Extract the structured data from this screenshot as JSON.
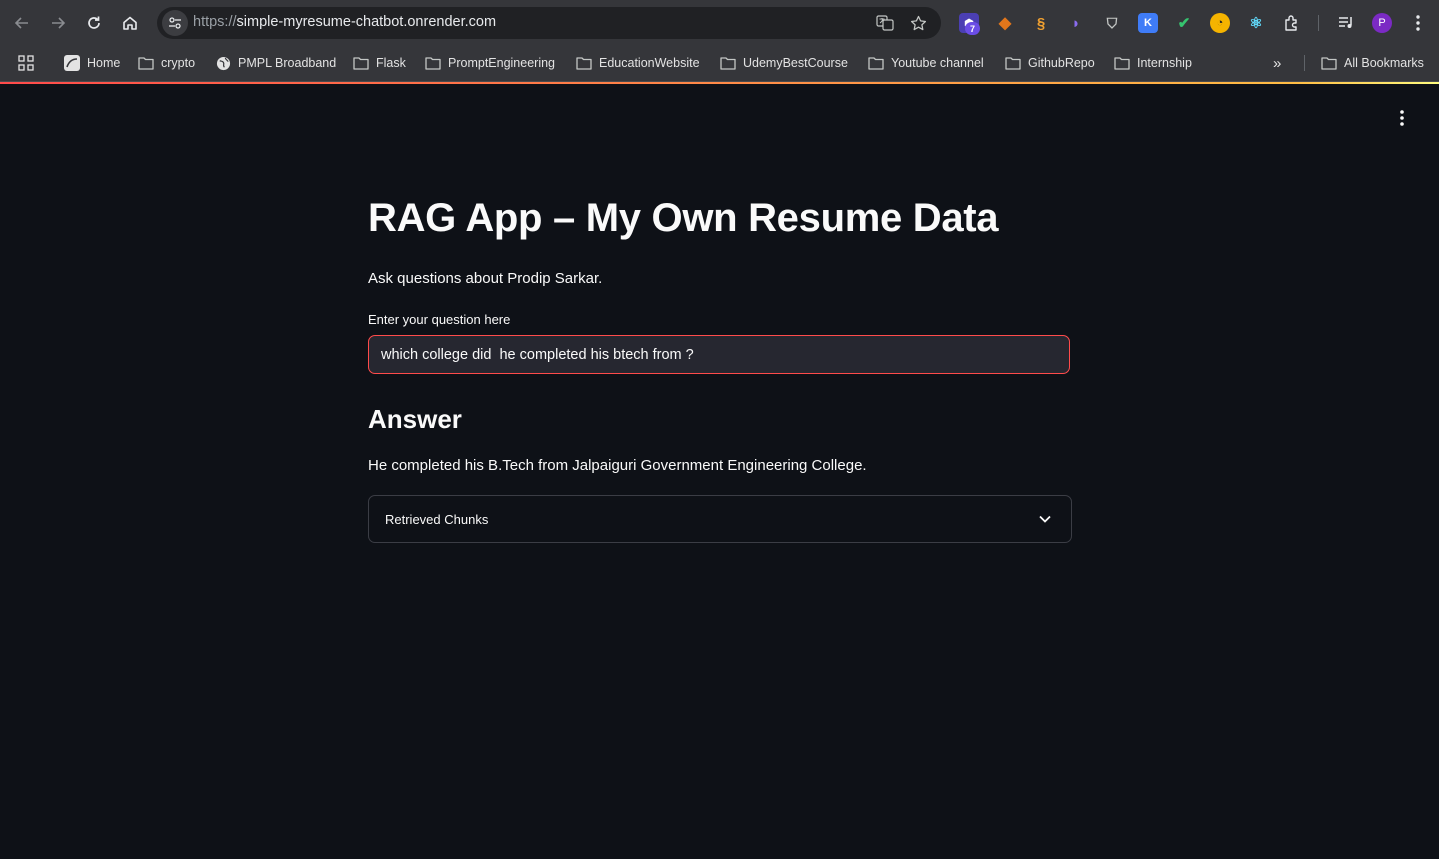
{
  "browser": {
    "url_scheme": "https://",
    "url_host": "simple-myresume-chatbot.onrender.com",
    "extension_badge": "7",
    "profile_initial": "P",
    "icons": [
      "back-icon",
      "forward-icon",
      "reload-icon",
      "home-icon",
      "site-info-icon",
      "translate-icon",
      "star-icon",
      "extensions-icon",
      "media-icon",
      "kebab-menu-icon"
    ]
  },
  "bookmarks": {
    "items": [
      {
        "label": "Home",
        "type": "page"
      },
      {
        "label": "crypto",
        "type": "folder"
      },
      {
        "label": "PMPL Broadband",
        "type": "page"
      },
      {
        "label": "Flask",
        "type": "folder"
      },
      {
        "label": "PromptEngineering",
        "type": "folder"
      },
      {
        "label": "EducationWebsite",
        "type": "folder"
      },
      {
        "label": "UdemyBestCourse",
        "type": "folder"
      },
      {
        "label": "Youtube channel",
        "type": "folder"
      },
      {
        "label": "GithubRepo",
        "type": "folder"
      },
      {
        "label": "Internship",
        "type": "folder"
      }
    ],
    "all_bookmarks": "All Bookmarks"
  },
  "app": {
    "title": "RAG App – My Own Resume Data",
    "subtitle": "Ask questions about Prodip Sarkar.",
    "input_label": "Enter your question here",
    "input_value": "which college did  he completed his btech from ?",
    "answer_heading": "Answer",
    "answer_text": "He completed his B.Tech from Jalpaiguri Government Engineering College.",
    "expander_label": "Retrieved Chunks"
  },
  "colors": {
    "background": "#0e1117",
    "primary": "#ff4b4b",
    "input_bg": "#262730",
    "text": "#fafafa"
  }
}
